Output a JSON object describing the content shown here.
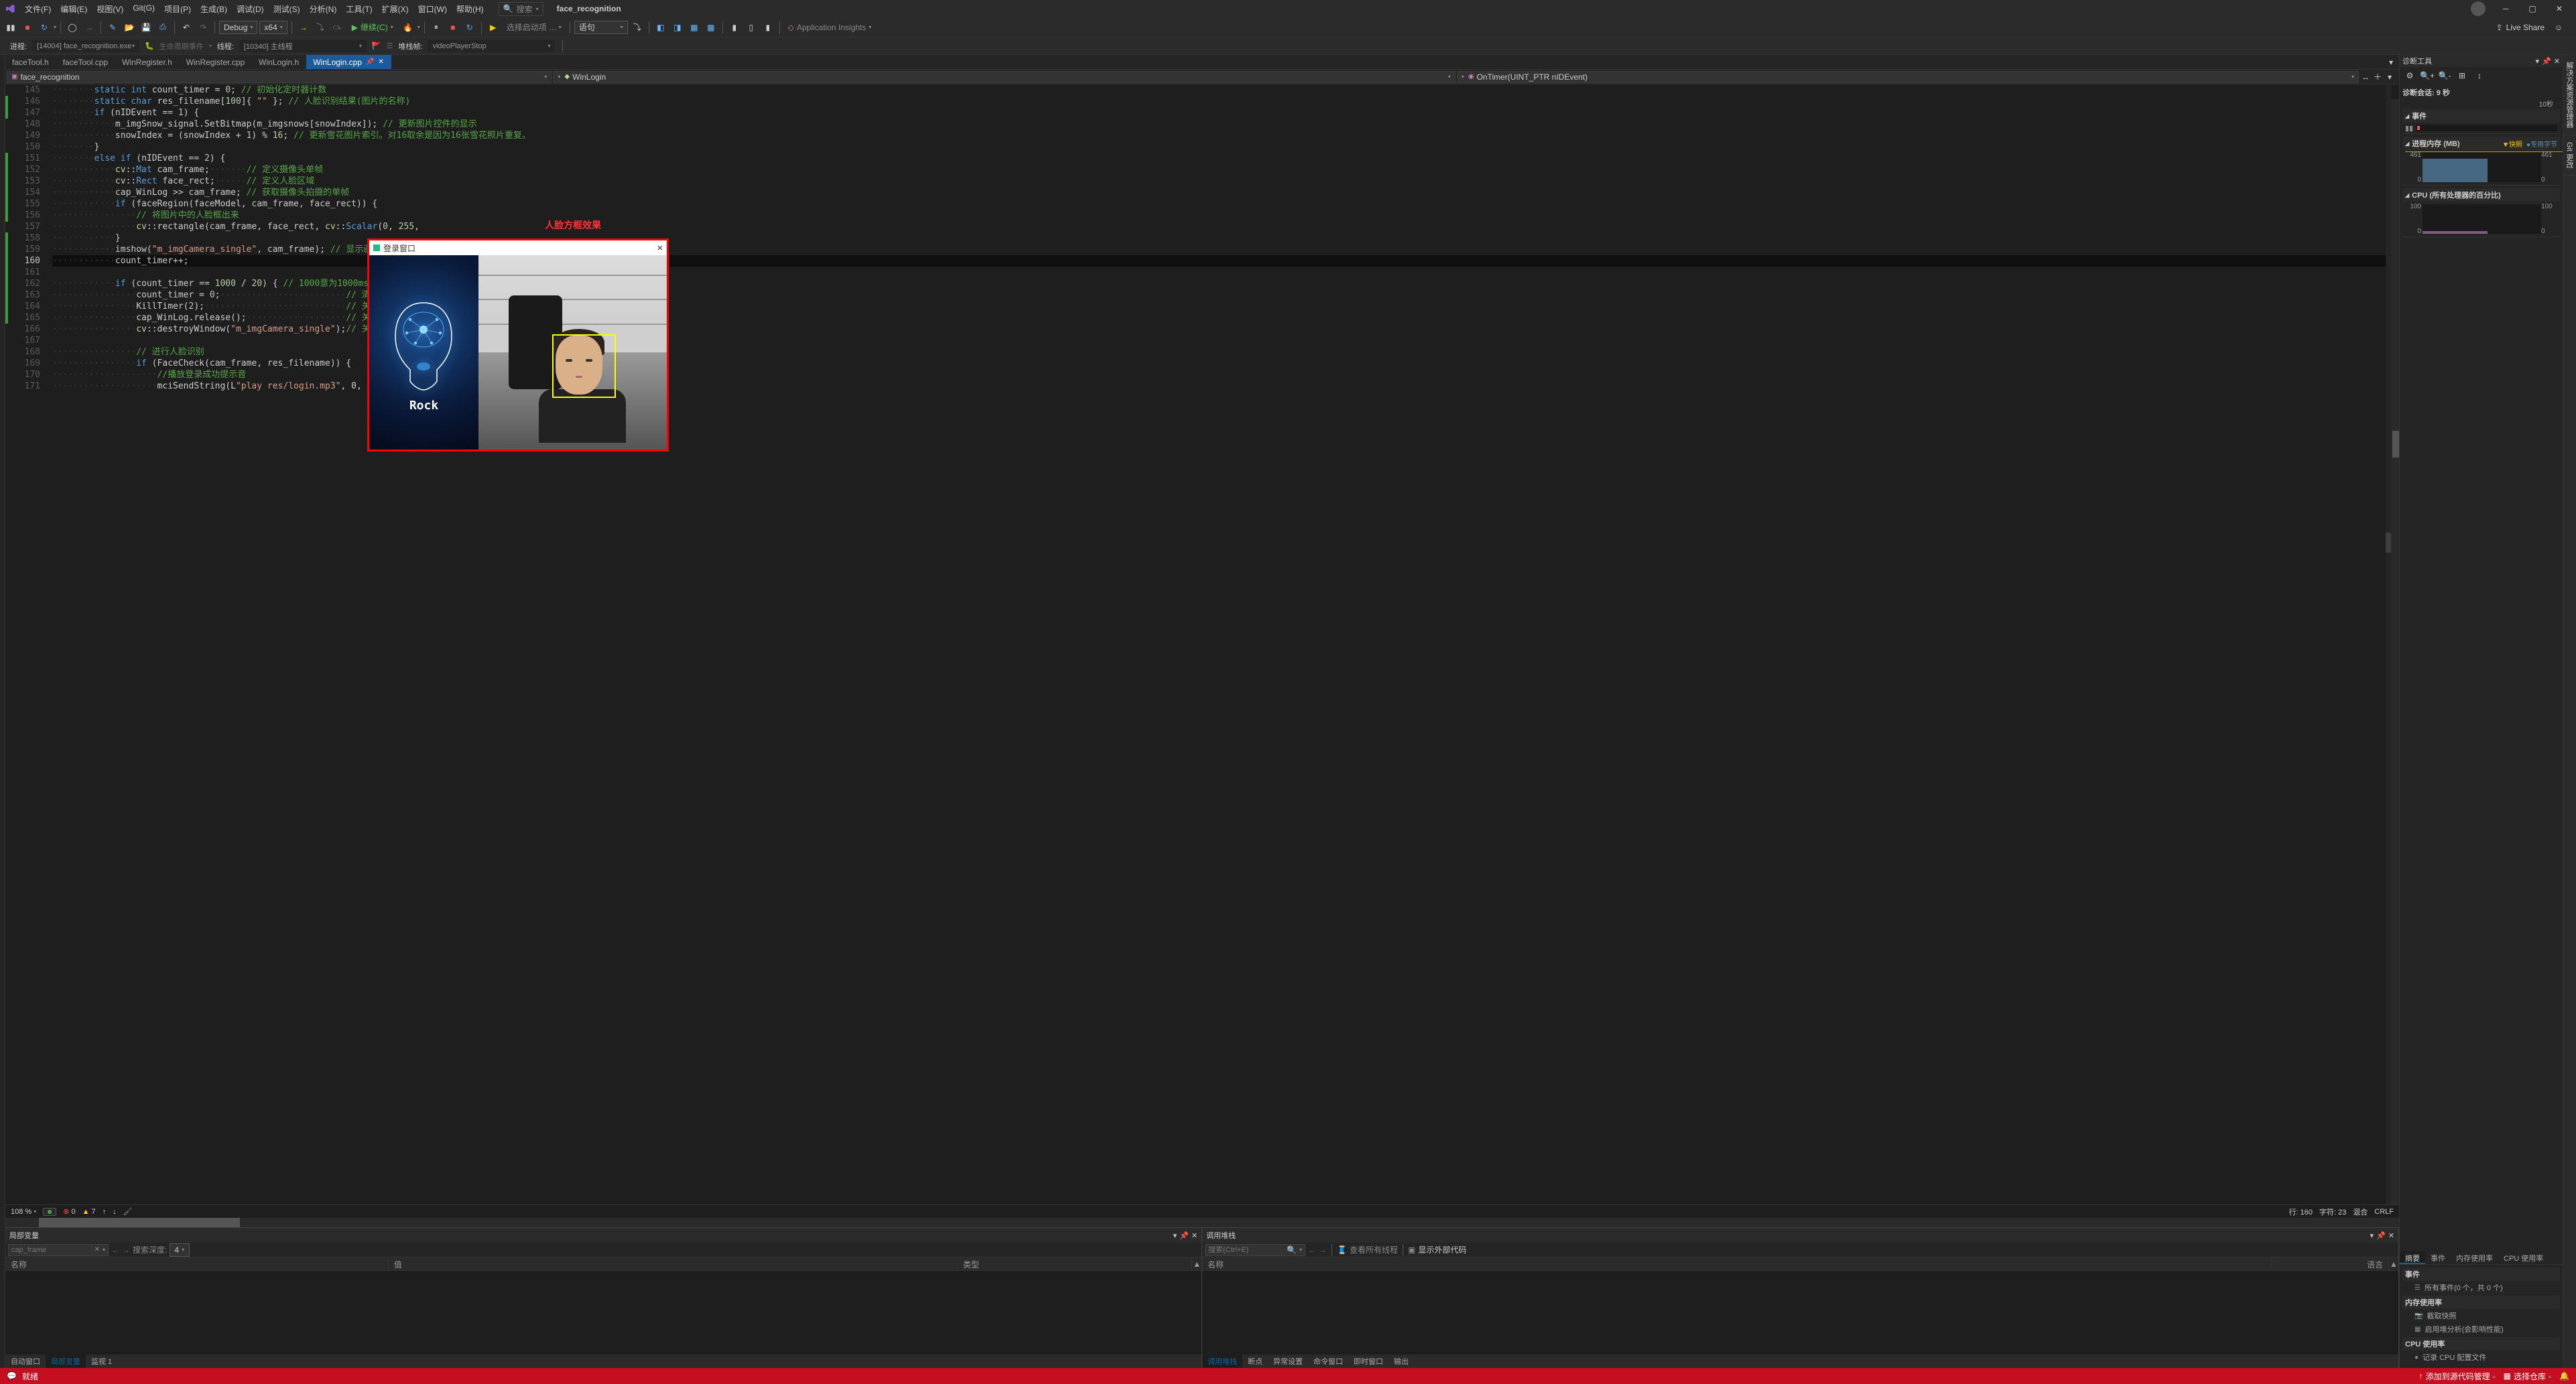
{
  "title_bar": {
    "menus": [
      "文件(F)",
      "编辑(E)",
      "视图(V)",
      "Git(G)",
      "项目(P)",
      "生成(B)",
      "调试(D)",
      "测试(S)",
      "分析(N)",
      "工具(T)",
      "扩展(X)",
      "窗口(W)",
      "帮助(H)"
    ],
    "search_placeholder": "搜索",
    "solution": "face_recognition"
  },
  "toolbar": {
    "config": "Debug",
    "platform": "x64",
    "continue_label": "继续(C)",
    "launch_options": "选择启动项",
    "step_unit": "语句",
    "app_insights": "Application Insights",
    "live_share": "Live Share"
  },
  "toolbar2": {
    "process_label": "进程:",
    "process_value": "[14004] face_recognition.exe",
    "lifecycle_label": "生命周期事件",
    "thread_label": "线程:",
    "thread_value": "[10340] 主线程",
    "stackframe_label": "堆栈帧:",
    "stackframe_value": "videoPlayerStop"
  },
  "file_tabs": [
    "faceTool.h",
    "faceTool.cpp",
    "WinRegister.h",
    "WinRegister.cpp",
    "WinLogin.h",
    "WinLogin.cpp"
  ],
  "active_tab_index": 5,
  "nav": {
    "project": "face_recognition",
    "scope": "WinLogin",
    "member": "OnTimer(UINT_PTR nIDEvent)"
  },
  "code": {
    "first_line": 145,
    "current_line": 160,
    "lines": [
      {
        "n": 145,
        "html": "<span class='ws'>········</span><span class='kw'>static</span> <span class='kw'>int</span> count_timer = <span class='num'>0</span>; <span class='cmt'>// 初始化定时器计数</span>"
      },
      {
        "n": 146,
        "html": "<span class='ws'>········</span><span class='kw'>static</span> <span class='kw'>char</span> res_filename[<span class='num'>100</span>]{ <span class='str'>\"\"</span> }; <span class='cmt'>// 人脸识别结果(图片的名称)</span>"
      },
      {
        "n": 147,
        "html": "<span class='ws'>········</span><span class='kw'>if</span> (nIDEvent == <span class='num'>1</span>) {"
      },
      {
        "n": 148,
        "html": "<span class='ws'>············</span>m_imgSnow_signal.SetBitmap(m_imgsnows[snowIndex]); <span class='cmt'>// 更新图片控件的显示</span>"
      },
      {
        "n": 149,
        "html": "<span class='ws'>············</span>snowIndex = (snowIndex + <span class='num'>1</span>) % <span class='num'>16</span>; <span class='cmt'>// 更新雪花图片索引。对16取余是因为16张雪花照片重复。</span>"
      },
      {
        "n": 150,
        "html": "<span class='ws'>········</span>}"
      },
      {
        "n": 151,
        "html": "<span class='ws'>········</span><span class='kw'>else</span> <span class='kw'>if</span> (nIDEvent == <span class='num'>2</span>) {"
      },
      {
        "n": 152,
        "html": "<span class='ws'>············</span><span class='ns'>cv</span>::<span class='type'>Mat</span> cam_frame;<span class='ws'>·······</span><span class='cmt'>// 定义摄像头单帧</span>"
      },
      {
        "n": 153,
        "html": "<span class='ws'>············</span><span class='ns'>cv</span>::<span class='type'>Rect</span> face_rect;<span class='ws'>······</span><span class='cmt'>// 定义人脸区域</span>"
      },
      {
        "n": 154,
        "html": "<span class='ws'>············</span>cap_WinLog >> cam_frame; <span class='cmt'>// 获取摄像头拍摄的单帧</span>"
      },
      {
        "n": 155,
        "html": "<span class='ws'>············</span><span class='kw'>if</span> (faceRegion(faceModel, cam_frame, face_rect)) {"
      },
      {
        "n": 156,
        "html": "<span class='ws'>················</span><span class='cmt'>// 将图片中的人脸框出来</span>"
      },
      {
        "n": 157,
        "html": "<span class='ws'>················</span><span class='ns'>cv</span>::rectangle(cam_frame, face_rect, <span class='ns'>cv</span>::<span class='type'>Scalar</span>(<span class='num'>0</span>, <span class='num'>255</span>,"
      },
      {
        "n": 158,
        "html": "<span class='ws'>············</span>}"
      },
      {
        "n": 159,
        "html": "<span class='ws'>············</span>imshow(<span class='str'>\"m_imgCamera_single\"</span>, cam_frame); <span class='cmt'>// 显示画面</span>"
      },
      {
        "n": 160,
        "html": "<span class='ws'>············</span>count_timer++;"
      },
      {
        "n": 161,
        "html": ""
      },
      {
        "n": 162,
        "html": "<span class='ws'>············</span><span class='kw'>if</span> (count_timer == <span class='num'>1000</span> / <span class='num'>20</span>) { <span class='cmt'>// 1000意为1000ms</span>"
      },
      {
        "n": 163,
        "html": "<span class='ws'>················</span>count_timer = <span class='num'>0</span>;<span class='ws'>························</span><span class='cmt'>// 清零计数</span>"
      },
      {
        "n": 164,
        "html": "<span class='ws'>················</span>KillTimer(<span class='num'>2</span>);<span class='ws'>···························</span><span class='cmt'>// 关闭定时器2</span>"
      },
      {
        "n": 165,
        "html": "<span class='ws'>················</span>cap_WinLog.release();<span class='ws'>···················</span><span class='cmt'>// 关闭摄像头</span>"
      },
      {
        "n": 166,
        "html": "<span class='ws'>················</span><span class='ns'>cv</span>::destroyWindow(<span class='str'>\"m_imgCamera_single\"</span>);<span class='cmt'>// 关闭摄像头显</span>"
      },
      {
        "n": 167,
        "html": ""
      },
      {
        "n": 168,
        "html": "<span class='ws'>················</span><span class='cmt'>// 进行人脸识别</span>"
      },
      {
        "n": 169,
        "html": "<span class='ws'>················</span><span class='kw'>if</span> (FaceCheck(cam_frame, res_filename)) {"
      },
      {
        "n": 170,
        "html": "<span class='ws'>····················</span><span class='cmt'>//播放登录成功提示音</span>"
      },
      {
        "n": 171,
        "html": "<span class='ws'>····················</span>mciSendString(L<span class='str'>\"play res/login.mp3\"</span>, 0, 0, 0);"
      }
    ]
  },
  "overlay": {
    "annotation": "人脸方框效果",
    "window_title": "登录窗口",
    "rock_label": "Rock"
  },
  "status_line": {
    "zoom": "108 %",
    "errors": "0",
    "warnings": "7",
    "line_label": "行: 160",
    "char_label": "字符: 23",
    "mode": "混合",
    "eol": "CRLF"
  },
  "bottom": {
    "left_title": "局部变量",
    "left_search_placeholder": "cap_frame",
    "depth_label": "搜索深度:",
    "depth_value": "4",
    "left_cols": [
      "名称",
      "值",
      "类型"
    ],
    "left_tabs": [
      "自动窗口",
      "局部变量",
      "监视 1"
    ],
    "right_title": "调用堆栈",
    "right_search_placeholder": "搜索(Ctrl+E)",
    "right_view_all": "查看所有线程",
    "right_show_ext": "显示外部代码",
    "right_cols": [
      "名称",
      "语言"
    ],
    "right_tabs": [
      "调用堆栈",
      "断点",
      "异常设置",
      "命令窗口",
      "即时窗口",
      "输出"
    ]
  },
  "diagnostics": {
    "title": "诊断工具",
    "session_label": "诊断会话: 9 秒",
    "timeline_tick": "10秒",
    "events_hdr": "事件",
    "memory_hdr": "进程内存 (MB)",
    "memory_legend1": "快照",
    "memory_legend2": "专用字节",
    "memory_y": [
      "461",
      "0"
    ],
    "memory_right": [
      "461",
      "0"
    ],
    "cpu_hdr": "CPU (所有处理器的百分比)",
    "cpu_y": [
      "100",
      "0"
    ],
    "cpu_right": [
      "100",
      "0"
    ],
    "detail_tabs": [
      "摘要",
      "事件",
      "内存使用率",
      "CPU 使用率"
    ],
    "events_section": "事件",
    "events_all": "所有事件(0 个，共 0 个)",
    "memory_section": "内存使用率",
    "memory_snapshot": "截取快照",
    "memory_heap": "启用堆分析(会影响性能)",
    "cpu_section": "CPU 使用率",
    "cpu_record": "记录 CPU 配置文件"
  },
  "right_tabs": [
    "解决方案资源管理器",
    "Git 更改"
  ],
  "final_status": {
    "ready": "就绪",
    "add_source": "添加到源代码管理",
    "select_repo": "选择仓库"
  },
  "chart_data": [
    {
      "type": "area",
      "title": "进程内存 (MB)",
      "ylabel": "MB",
      "ylim": [
        0,
        461
      ],
      "x_range_seconds": [
        0,
        10
      ],
      "series": [
        {
          "name": "专用字节",
          "values_approx": [
            350,
            370,
            400,
            400,
            400,
            400
          ],
          "note": "roughly flat ~400MB over session"
        }
      ]
    },
    {
      "type": "area",
      "title": "CPU (所有处理器的百分比)",
      "ylabel": "%",
      "ylim": [
        0,
        100
      ],
      "x_range_seconds": [
        0,
        10
      ],
      "series": [
        {
          "name": "CPU",
          "values_approx": [
            2,
            3,
            5,
            4,
            3,
            8
          ],
          "note": "low <10% with small spikes"
        }
      ]
    }
  ]
}
